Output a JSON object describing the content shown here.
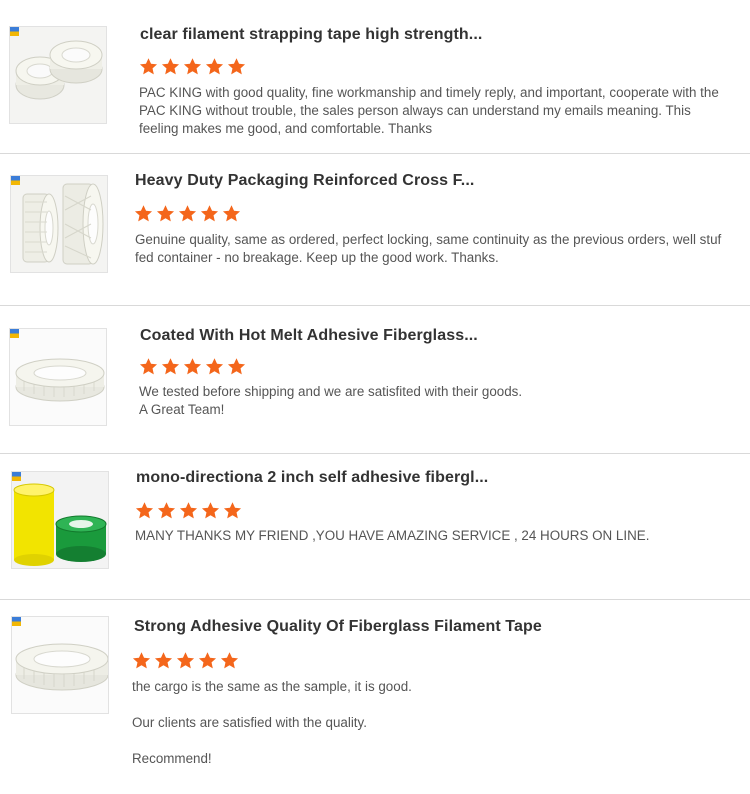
{
  "colors": {
    "star": "#f4661b",
    "title": "#333333",
    "text": "#555555",
    "divider": "#d9d9d9"
  },
  "reviews": [
    {
      "product_image": "clear-filament-tape-rolls",
      "title": "clear filament strapping tape high strength...",
      "rating": 5,
      "lines": [
        "PAC KING with good quality, fine workmanship and timely reply, and important, cooperate with the",
        "PAC KING without trouble, the sales person always can understand my emails meaning. This",
        "feeling makes me good, and comfortable. Thanks"
      ]
    },
    {
      "product_image": "reinforced-cross-filament-tape-rolls",
      "title": "Heavy Duty Packaging Reinforced Cross F...",
      "rating": 5,
      "lines": [
        "Genuine quality, same as ordered, perfect locking, same continuity as the previous orders, well stuf",
        "fed container - no breakage. Keep up the good work. Thanks."
      ]
    },
    {
      "product_image": "fiberglass-tape-roll",
      "title": "Coated With Hot Melt Adhesive Fiberglass...",
      "rating": 5,
      "lines": [
        "We tested before shipping and we are satisfited with their goods.",
        "A Great Team!"
      ]
    },
    {
      "product_image": "yellow-and-green-tape-rolls",
      "title": "mono-directiona 2 inch self adhesive fibergl...",
      "rating": 5,
      "lines": [
        "MANY THANKS MY FRIEND ,YOU HAVE AMAZING SERVICE , 24 HOURS ON LINE."
      ]
    },
    {
      "product_image": "fiberglass-filament-tape-roll",
      "title": "Strong Adhesive Quality Of Fiberglass Filament Tape",
      "rating": 5,
      "lines": [
        "the cargo is the same as the sample, it is good.",
        "",
        "Our clients are satisfied with the quality.",
        "",
        "Recommend!"
      ]
    }
  ]
}
